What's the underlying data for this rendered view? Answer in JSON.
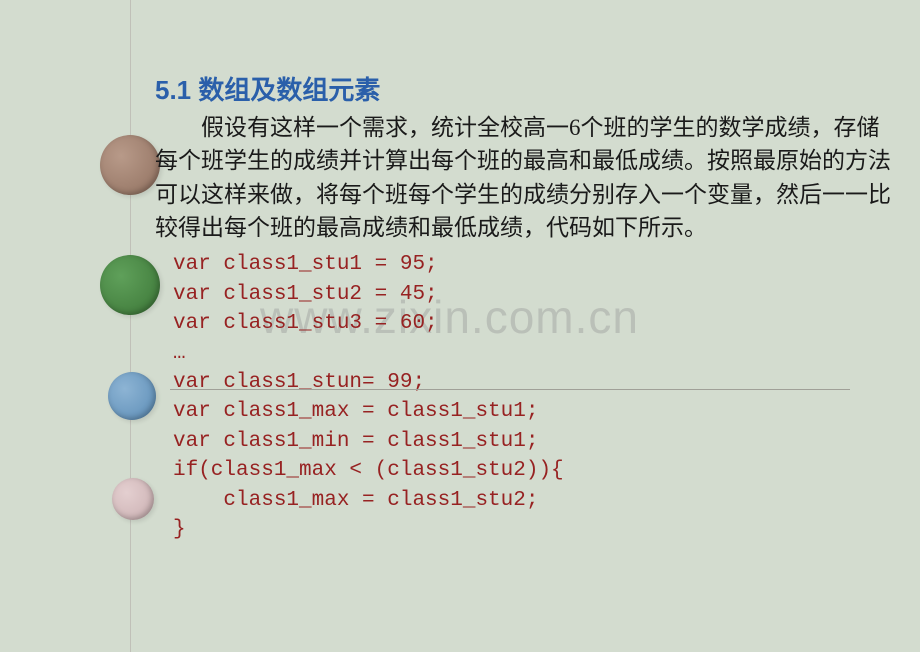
{
  "heading": "5.1  数组及数组元素",
  "paragraph": "假设有这样一个需求，统计全校高一6个班的学生的数学成绩，存储每个班学生的成绩并计算出每个班的最高和最低成绩。按照最原始的方法可以这样来做，将每个班每个学生的成绩分别存入一个变量，然后一一比较得出每个班的最高成绩和最低成绩，代码如下所示。",
  "code": {
    "lines": [
      "var class1_stu1 = 95;",
      "var class1_stu2 = 45;",
      "var class1_stu3 = 60;",
      "…",
      "var class1_stun= 99;",
      "var class1_max = class1_stu1;",
      "var class1_min = class1_stu1;",
      "if(class1_max < (class1_stu2)){",
      "    class1_max = class1_stu2;",
      "}"
    ]
  },
  "watermark": "www.zixin.com.cn"
}
